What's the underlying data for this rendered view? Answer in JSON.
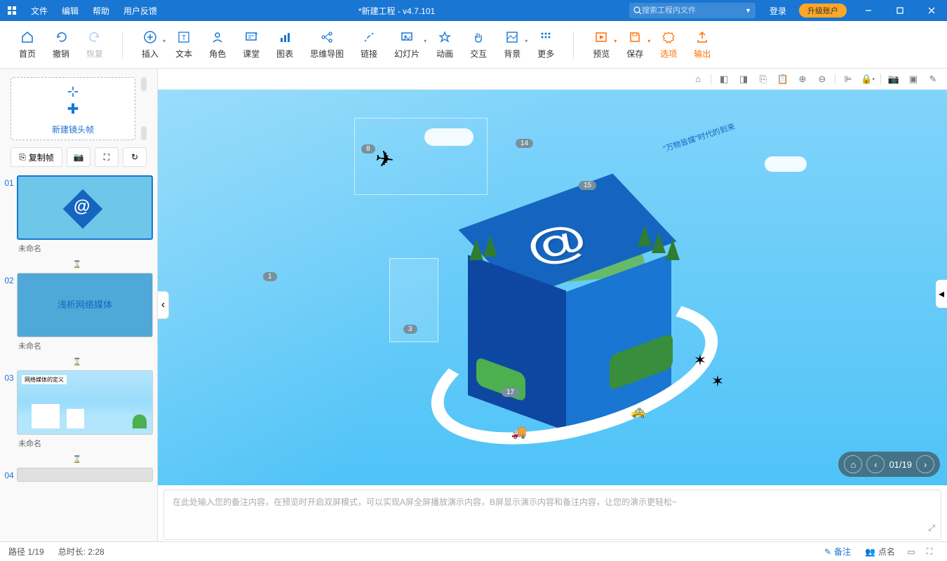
{
  "titlebar": {
    "menus": [
      "文件",
      "编辑",
      "帮助",
      "用户反馈"
    ],
    "title": "*新建工程 - v4.7.101",
    "search_placeholder": "搜索工程内文件",
    "login": "登录",
    "upgrade": "升级账户"
  },
  "toolbar": {
    "home": "首页",
    "undo": "撤销",
    "redo": "恢复",
    "insert": "插入",
    "text": "文本",
    "role": "角色",
    "classroom": "课堂",
    "chart": "图表",
    "mindmap": "思维导图",
    "link": "链接",
    "slide": "幻灯片",
    "animation": "动画",
    "interaction": "交互",
    "background": "背景",
    "more": "更多",
    "preview": "预览",
    "save": "保存",
    "options": "选项",
    "output": "输出"
  },
  "sidebar": {
    "new_frame": "新建镜头帧",
    "copy_frame": "复制帧",
    "thumbs": [
      {
        "num": "01",
        "label": "未命名"
      },
      {
        "num": "02",
        "label": "未命名",
        "text": "浅析网络媒体"
      },
      {
        "num": "03",
        "label": "未命名",
        "tag": "网络媒体的定义"
      },
      {
        "num": "04",
        "label": ""
      }
    ]
  },
  "canvas": {
    "markers": [
      "8",
      "14",
      "1",
      "3",
      "17",
      "15"
    ],
    "nav_page": "01/19",
    "annotation_text": "\"万物皆媒\"时代的到来"
  },
  "notes": {
    "placeholder": "在此处输入您的备注内容，在预览时开启双屏模式，可以实现A屏全屏播放演示内容，B屏显示演示内容和备注内容，让您的演示更轻松~"
  },
  "statusbar": {
    "path": "路径 1/19",
    "duration": "总时长: 2:28",
    "remark": "备注",
    "roll_call": "点名"
  }
}
